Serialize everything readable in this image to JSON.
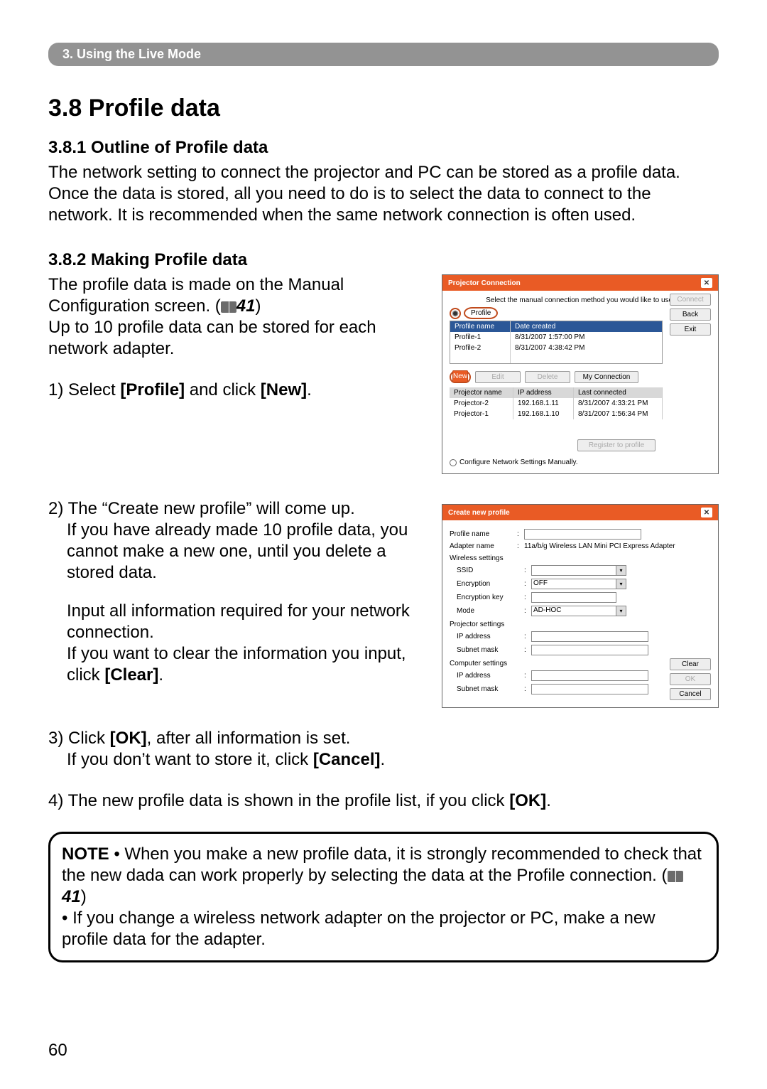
{
  "header": {
    "chapter": "3. Using the Live Mode"
  },
  "section": {
    "title": "3.8 Profile data",
    "sub1": {
      "title": "3.8.1 Outline of Profile data",
      "text": "The network setting to connect the projector and PC can be stored as a profile data. Once the data is stored, all you need to do is to select the data to connect to the network. It is recommended when the same network connection is often used."
    },
    "sub2": {
      "title": "3.8.2 Making Profile data",
      "p1a": "The profile data is made on the Manual Configuration screen. (",
      "p1ref": "41",
      "p1b": ")",
      "p2": "Up to 10 profile data can be stored for each network adapter.",
      "step1_pre": "1) Select ",
      "step1_b1": "[Profile]",
      "step1_mid": " and click ",
      "step1_b2": "[New]",
      "step1_end": ".",
      "step2a": "2) The “Create new profile” will come up.",
      "step2b": "If you have already made 10 profile data, you cannot make a new one, until you delete a stored data.",
      "step2c": "Input all information required for your network connection.",
      "step2d_pre": "If you want to clear the information you input, click ",
      "step2d_b": "[Clear]",
      "step2d_end": ".",
      "step3_pre": "3) Click ",
      "step3_b1": "[OK]",
      "step3_mid": ", after all information is set.",
      "step3_line2_pre": "If you don’t want to store it, click ",
      "step3_line2_b": "[Cancel]",
      "step3_line2_end": ".",
      "step4_pre": "4) The new profile data is shown in the profile list, if you click ",
      "step4_b": "[OK]",
      "step4_end": "."
    }
  },
  "note": {
    "label": "NOTE",
    "l1": "  • When you make a new profile data, it is strongly recommended to check that the new dada can work properly by selecting the data at the Profile connection. (",
    "ref": "41",
    "l1b": ")",
    "l2": "• If you change a wireless network adapter on the projector or PC, make a new profile data for the adapter."
  },
  "page": "60",
  "dlg1": {
    "title": "Projector Connection",
    "prompt": "Select the manual connection method you would like to use:",
    "radio": "Profile",
    "btn_connect": "Connect",
    "btn_back": "Back",
    "btn_exit": "Exit",
    "hdr_name": "Profile name",
    "hdr_date": "Date created",
    "rows": [
      {
        "name": "Profile-1",
        "date": "8/31/2007 1:57:00 PM"
      },
      {
        "name": "Profile-2",
        "date": "8/31/2007 4:38:42 PM"
      }
    ],
    "btn_new": "New",
    "btn_edit": "Edit",
    "btn_delete": "Delete",
    "btn_myconn": "My Connection",
    "hdr_pn": "Projector name",
    "hdr_ip": "IP address",
    "hdr_lc": "Last connected",
    "rows2": [
      {
        "pn": "Projector-2",
        "ip": "192.168.1.11",
        "lc": "8/31/2007 4:33:21 PM"
      },
      {
        "pn": "Projector-1",
        "ip": "192.168.1.10",
        "lc": "8/31/2007 1:56:34 PM"
      }
    ],
    "btn_reg": "Register to profile",
    "chk": "Configure Network Settings Manually."
  },
  "dlg2": {
    "title": "Create new profile",
    "profile_name": "Profile name",
    "adapter_label": "Adapter name",
    "adapter_value": "11a/b/g Wireless LAN Mini PCI Express Adapter",
    "grp_wireless": "Wireless settings",
    "ssid": "SSID",
    "enc": "Encryption",
    "enc_val": "OFF",
    "enckey": "Encryption key",
    "mode": "Mode",
    "mode_val": "AD-HOC",
    "grp_proj": "Projector settings",
    "ip": "IP address",
    "subnet": "Subnet mask",
    "grp_comp": "Computer settings",
    "btn_clear": "Clear",
    "btn_ok": "OK",
    "btn_cancel": "Cancel"
  }
}
